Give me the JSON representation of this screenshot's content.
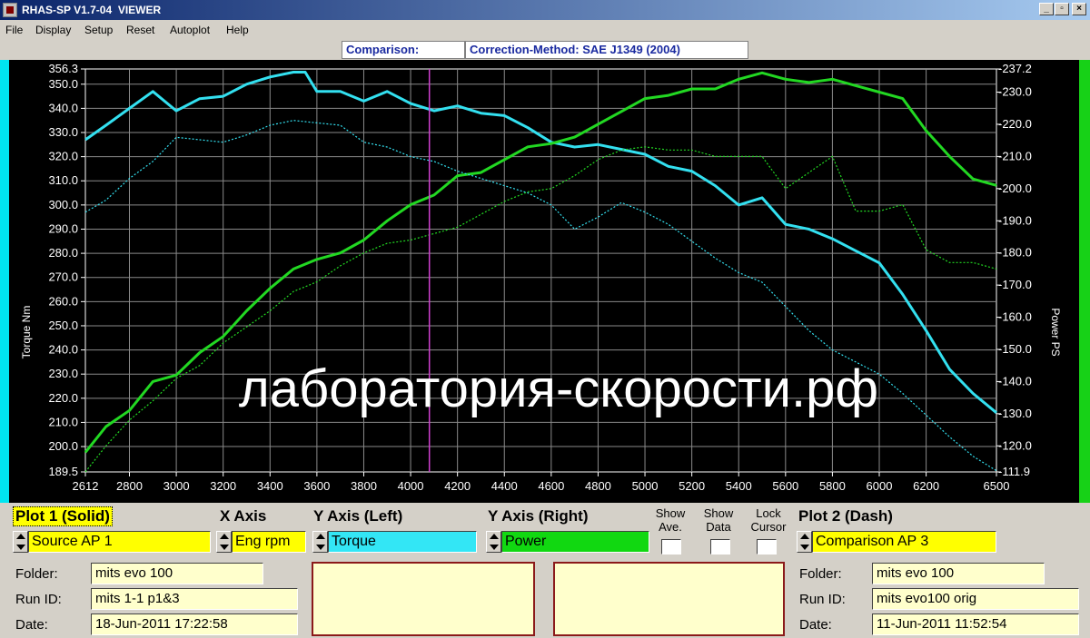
{
  "window": {
    "title": "RHAS-SP V1.7-04  VIEWER",
    "min_label": "_",
    "max_label": "▫",
    "close_label": "×"
  },
  "menu": [
    "File",
    "Display",
    "Setup",
    "Reset",
    "Autoplot",
    "Help"
  ],
  "header": {
    "comparison": "Comparison:",
    "correction": "Correction-Method: SAE J1349 (2004)"
  },
  "watermark": "лаборатория-скорости.рф",
  "colors": {
    "torque": "#33e0f0",
    "power": "#22d822",
    "cursor": "#d040d0",
    "grid": "#8a8a8a"
  },
  "chart_data": {
    "type": "line",
    "xlabel": "",
    "ylabel_left": "Torque Nm",
    "ylabel_right": "Power PS",
    "xlim": [
      2612,
      6500
    ],
    "ylim_left": [
      189.5,
      356.3
    ],
    "ylim_right": [
      111.9,
      237.2
    ],
    "x_ticks": [
      "2612",
      "2800",
      "3000",
      "3200",
      "3400",
      "3600",
      "3800",
      "4000",
      "4200",
      "4400",
      "4600",
      "4800",
      "5000",
      "5200",
      "5400",
      "5600",
      "5800",
      "6000",
      "6200",
      "6500"
    ],
    "y_left_ticks": [
      "356.3",
      "350.0",
      "340.0",
      "330.0",
      "320.0",
      "310.0",
      "300.0",
      "290.0",
      "280.0",
      "270.0",
      "260.0",
      "250.0",
      "240.0",
      "230.0",
      "220.0",
      "210.0",
      "200.0",
      "189.5"
    ],
    "y_right_ticks": [
      "237.2",
      "230.0",
      "220.0",
      "210.0",
      "200.0",
      "190.0",
      "180.0",
      "170.0",
      "160.0",
      "150.0",
      "140.0",
      "130.0",
      "120.0",
      "111.9"
    ],
    "cursor_x": 4080,
    "series": [
      {
        "name": "Torque",
        "plot": "Plot 1 (Solid)",
        "axis": "left",
        "style": "solid",
        "x": [
          2612,
          2700,
          2800,
          2900,
          3000,
          3100,
          3200,
          3300,
          3400,
          3500,
          3550,
          3600,
          3700,
          3800,
          3900,
          4000,
          4100,
          4200,
          4300,
          4400,
          4500,
          4600,
          4700,
          4800,
          4900,
          5000,
          5100,
          5200,
          5300,
          5400,
          5500,
          5600,
          5700,
          5800,
          5900,
          6000,
          6100,
          6200,
          6300,
          6400,
          6500
        ],
        "y": [
          327,
          333,
          340,
          347,
          339,
          344,
          345,
          350,
          353,
          355,
          355,
          347,
          347,
          343,
          347,
          342,
          339,
          341,
          338,
          337,
          332,
          326,
          324,
          325,
          323,
          321,
          316,
          314,
          308,
          300,
          303,
          292,
          290,
          286,
          281,
          276,
          263,
          248,
          232,
          222,
          214
        ]
      },
      {
        "name": "Power",
        "plot": "Plot 1 (Solid)",
        "axis": "right",
        "style": "solid",
        "x": [
          2612,
          2700,
          2800,
          2900,
          3000,
          3100,
          3200,
          3300,
          3400,
          3500,
          3600,
          3700,
          3800,
          3900,
          4000,
          4100,
          4200,
          4300,
          4400,
          4500,
          4600,
          4700,
          4800,
          4900,
          5000,
          5100,
          5200,
          5300,
          5400,
          5500,
          5600,
          5700,
          5800,
          5900,
          6000,
          6100,
          6200,
          6300,
          6400,
          6500
        ],
        "y": [
          118,
          126,
          131,
          140,
          142,
          149,
          154,
          162,
          169,
          175,
          178,
          180,
          184,
          190,
          195,
          198,
          204,
          205,
          209,
          213,
          214,
          216,
          220,
          224,
          228,
          229,
          231,
          231,
          234,
          236,
          234,
          233,
          234,
          232,
          230,
          228,
          218,
          210,
          203,
          201
        ]
      },
      {
        "name": "Torque",
        "plot": "Plot 2 (Dash)",
        "axis": "left",
        "style": "dash",
        "x": [
          2612,
          2700,
          2800,
          2900,
          3000,
          3100,
          3200,
          3300,
          3400,
          3500,
          3600,
          3700,
          3800,
          3900,
          4000,
          4100,
          4200,
          4300,
          4400,
          4500,
          4600,
          4700,
          4800,
          4900,
          5000,
          5100,
          5200,
          5300,
          5400,
          5500,
          5600,
          5700,
          5800,
          5900,
          6000,
          6100,
          6200,
          6300,
          6400,
          6500
        ],
        "y": [
          297,
          302,
          311,
          318,
          328,
          327,
          326,
          329,
          333,
          335,
          334,
          333,
          326,
          324,
          320,
          318,
          314,
          311,
          308,
          305,
          300,
          290,
          295,
          301,
          297,
          292,
          285,
          278,
          272,
          268,
          258,
          248,
          240,
          235,
          230,
          222,
          213,
          204,
          196,
          190
        ]
      },
      {
        "name": "Power",
        "plot": "Plot 2 (Dash)",
        "axis": "right",
        "style": "dash",
        "x": [
          2612,
          2700,
          2800,
          2900,
          3000,
          3100,
          3200,
          3300,
          3400,
          3500,
          3600,
          3700,
          3800,
          3900,
          4000,
          4100,
          4200,
          4300,
          4400,
          4500,
          4600,
          4700,
          4800,
          4900,
          5000,
          5100,
          5200,
          5300,
          5400,
          5500,
          5600,
          5700,
          5800,
          5900,
          6000,
          6100,
          6200,
          6300,
          6400,
          6500
        ],
        "y": [
          111.9,
          120,
          128,
          134,
          141,
          145,
          152,
          157,
          162,
          168,
          171,
          176,
          180,
          183,
          184,
          186,
          188,
          192,
          196,
          199,
          200,
          204,
          209,
          212,
          213,
          212,
          212,
          210,
          210,
          210,
          200,
          205,
          210,
          193,
          193,
          195,
          181,
          177,
          177,
          175
        ]
      }
    ]
  },
  "panel": {
    "plot1_title": "Plot 1 (Solid)",
    "xaxis_title": "X Axis",
    "yleft_title": "Y Axis (Left)",
    "yright_title": "Y Axis (Right)",
    "plot2_title": "Plot 2 (Dash)",
    "show_ave": "Show\nAve.",
    "show_data": "Show\nData",
    "lock_cursor": "Lock\nCursor",
    "source1": "Source AP 1",
    "xaxis_value": "Eng rpm",
    "yleft_value": "Torque",
    "yright_value": "Power",
    "source2": "Comparison AP 3",
    "left": {
      "folder_label": "Folder:",
      "folder": "mits evo 100",
      "run_label": "Run ID:",
      "run": "mits 1-1 p1&3",
      "date_label": "Date:",
      "date": "18-Jun-2011  17:22:58"
    },
    "right": {
      "folder_label": "Folder:",
      "folder": "mits evo 100",
      "run_label": "Run ID:",
      "run": "mits evo100 orig",
      "date_label": "Date:",
      "date": "11-Jun-2011  11:52:54"
    }
  }
}
